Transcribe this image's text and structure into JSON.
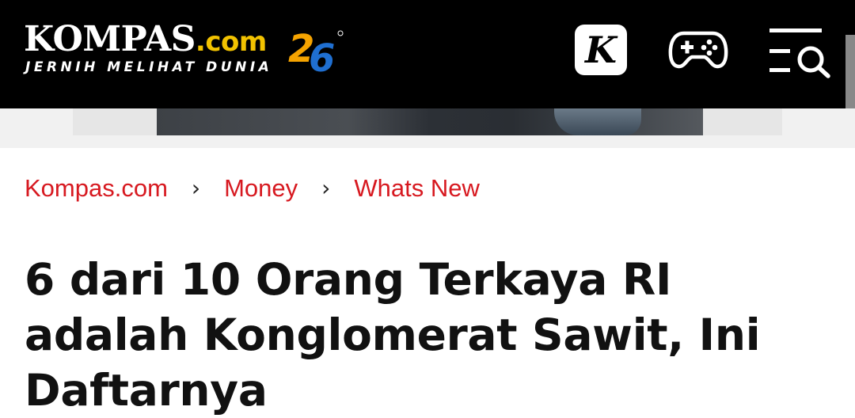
{
  "header": {
    "brand_name": "KOMPAS",
    "brand_suffix": ".com",
    "tagline": "JERNIH MELIHAT DUNIA",
    "anniversary_mark": "26",
    "kompas_button_letter": "K",
    "colors": {
      "background": "#000000",
      "brand_suffix": "#f2c200",
      "accent_blue": "#1f6fd1",
      "accent_orange": "#f5a300"
    },
    "icons": [
      "kompas-k-icon",
      "gamepad-icon",
      "menu-search-icon"
    ]
  },
  "breadcrumb": {
    "items": [
      "Kompas.com",
      "Money",
      "Whats New"
    ],
    "separator": "›",
    "color": "#d71920"
  },
  "article": {
    "title": "6 dari 10 Orang Terkaya RI adalah Konglomerat Sawit, Ini Daftarnya"
  }
}
